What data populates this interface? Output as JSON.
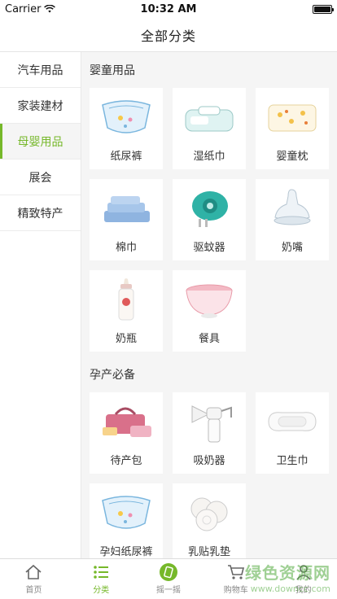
{
  "status_bar": {
    "carrier": "Carrier",
    "time": "10:32 AM"
  },
  "nav": {
    "title": "全部分类"
  },
  "sidebar": {
    "items": [
      {
        "label": "汽车用品",
        "active": false
      },
      {
        "label": "家装建材",
        "active": false
      },
      {
        "label": "母婴用品",
        "active": true
      },
      {
        "label": "展会",
        "active": false
      },
      {
        "label": "精致特产",
        "active": false
      }
    ]
  },
  "sections": [
    {
      "title": "婴童用品",
      "products": [
        {
          "label": "纸尿裤",
          "icon": "diaper-icon"
        },
        {
          "label": "湿纸巾",
          "icon": "wet-wipes-icon"
        },
        {
          "label": "婴童枕",
          "icon": "baby-pillow-icon"
        },
        {
          "label": "棉巾",
          "icon": "cotton-towel-icon"
        },
        {
          "label": "驱蚊器",
          "icon": "mosquito-repeller-icon"
        },
        {
          "label": "奶嘴",
          "icon": "pacifier-nipple-icon"
        },
        {
          "label": "奶瓶",
          "icon": "baby-bottle-icon"
        },
        {
          "label": "餐具",
          "icon": "bowl-icon"
        }
      ]
    },
    {
      "title": "孕产必备",
      "products": [
        {
          "label": "待产包",
          "icon": "maternity-bag-icon"
        },
        {
          "label": "吸奶器",
          "icon": "breast-pump-icon"
        },
        {
          "label": "卫生巾",
          "icon": "sanitary-pad-icon"
        },
        {
          "label": "孕妇纸尿裤",
          "icon": "maternity-diaper-icon"
        },
        {
          "label": "乳贴乳垫",
          "icon": "nursing-pad-icon"
        }
      ]
    }
  ],
  "tab_bar": {
    "items": [
      {
        "label": "首页",
        "icon": "home-icon",
        "active": false
      },
      {
        "label": "分类",
        "icon": "list-icon",
        "active": true
      },
      {
        "label": "摇一摇",
        "icon": "shake-icon",
        "active": false
      },
      {
        "label": "购物车",
        "icon": "cart-icon",
        "active": false
      },
      {
        "label": "我的",
        "icon": "profile-icon",
        "active": false
      }
    ]
  },
  "watermark": {
    "title": "绿色资源网",
    "url": "www.downcc.com"
  },
  "colors": {
    "accent": "#76b82a",
    "background": "#f5f5f5"
  }
}
